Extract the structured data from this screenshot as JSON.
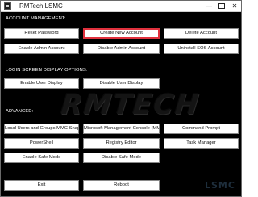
{
  "window": {
    "title": "RMTech LSMC",
    "minimize": "—",
    "close": "✕"
  },
  "watermark": {
    "main": "RMTECH",
    "sub": "LSMC"
  },
  "sections": {
    "account": "ACCOUNT MANAGEMENT:",
    "login": "LOGIN SCREEN DISPLAY OPTIONS:",
    "advanced": "ADVANCED:"
  },
  "buttons": {
    "reset_password": "Reset Password",
    "create_new_account": "Create New Account",
    "delete_account": "Delete Account",
    "enable_admin_account": "Enable Admin Account",
    "disable_admin_account": "Disable Admin Account",
    "uninstall_sos_account": "Uninstall SOS Account",
    "enable_user_display": "Enable User Display",
    "disable_user_display": "Disable User Display",
    "local_users_groups": "Local Users and Groups MMC Snap-in",
    "mmc": "Microsoft Management Console (MMC)",
    "command_prompt": "Command Prompt",
    "powershell": "PowerShell",
    "registry_editor": "Registry Editor",
    "task_manager": "Task Manager",
    "enable_safe_mode": "Enable Safe Mode",
    "disable_safe_mode": "Disable Safe Mode",
    "exit": "Exit",
    "reboot": "Reboot"
  },
  "colors": {
    "background": "#000000",
    "highlight_border": "#e0313d"
  }
}
